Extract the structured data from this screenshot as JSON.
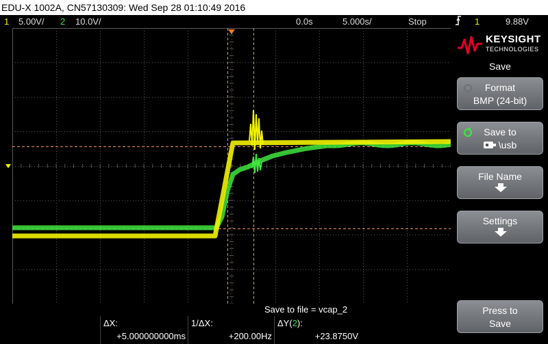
{
  "title_bar": "EDU-X 1002A, CN57130309: Wed Sep 28 01:10:49 2016",
  "status": {
    "ch1_num": "1",
    "ch1_scale": "5.00V/",
    "ch2_num": "2",
    "ch2_scale": "10.0V/",
    "delay": "0.0s",
    "timebase": "5.000s/",
    "run_state": "Stop",
    "trigger_icon": "trigger-edge-icon",
    "trigger_ch": "1",
    "trigger_level": "9.88V"
  },
  "brand": {
    "name": "KEYSIGHT",
    "sub": "TECHNOLOGIES",
    "color": "#e0002a"
  },
  "menu": {
    "title": "Save",
    "softkeys": [
      {
        "line1": "Format",
        "line2": "BMP (24-bit)"
      },
      {
        "line1": "Save to",
        "line2": "\\usb"
      },
      {
        "line1": "File Name",
        "line2": ""
      },
      {
        "line1": "Settings",
        "line2": ""
      },
      {
        "line1": "Press to",
        "line2": "Save"
      }
    ]
  },
  "message": "Save to file =  vcap_2",
  "cursors": {
    "dx_label": "ΔX:",
    "dx_value": "+5.000000000ms",
    "inv_dx_label": "1/ΔX:",
    "inv_dx_value": "+200.00Hz",
    "dy_label_prefix": "ΔY(",
    "dy_channel": "2",
    "dy_label_suffix": "):",
    "dy_value": "+23.8750V"
  },
  "colors": {
    "ch1": "#f2f200",
    "ch2": "#3ee53e",
    "cursor": "#e8906a",
    "grid": "#5a5a5a"
  },
  "markers": {
    "trigger_marker": "T",
    "ch1_marker": "1",
    "ch2_marker": "2"
  }
}
